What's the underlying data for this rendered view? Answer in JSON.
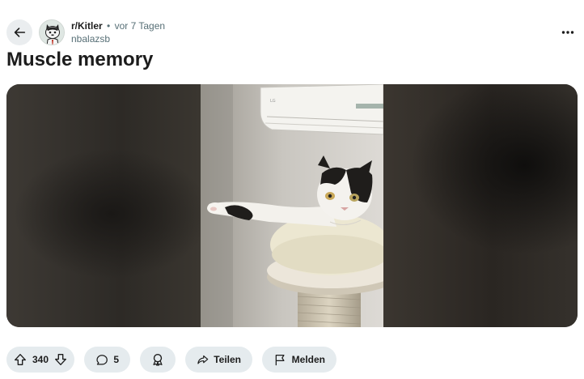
{
  "post": {
    "subreddit": "r/Kitler",
    "separator": "•",
    "time_ago": "vor 7 Tagen",
    "author": "nbalazsb",
    "title": "Muscle memory"
  },
  "actions": {
    "vote_count": "340",
    "comment_count": "5",
    "share_label": "Teilen",
    "report_label": "Melden"
  },
  "icons": {
    "back": "arrow-left-icon",
    "more": "more-horizontal-icon",
    "upvote": "arrow-up-icon",
    "downvote": "arrow-down-icon",
    "comment": "speech-bubble-icon",
    "award": "award-ribbon-icon",
    "share": "share-arrow-icon",
    "report": "flag-icon"
  },
  "colors": {
    "pill_bg": "#e5ebee",
    "meta_gray": "#576f76",
    "text": "#1c1c1c"
  }
}
